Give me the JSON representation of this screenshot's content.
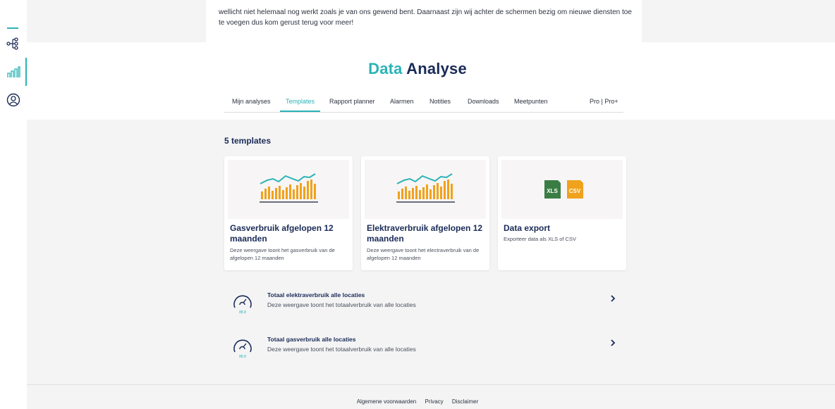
{
  "sidebar": {
    "icons": [
      "network-icon",
      "bar-chart-icon",
      "user-icon"
    ]
  },
  "intro": {
    "text": "wellicht niet helemaal nog werkt zoals je van ons gewend bent. Daarnaast zijn wij achter de schermen bezig om nieuwe diensten toe te voegen dus kom gerust terug voor meer!"
  },
  "page": {
    "title_part1": "Data",
    "title_part2": "Analyse"
  },
  "tabs": [
    {
      "label": "Mijn analyses",
      "active": false
    },
    {
      "label": "Templates",
      "active": true
    },
    {
      "label": "Rapport planner",
      "active": false
    },
    {
      "label": "Alarmen",
      "active": false
    },
    {
      "label": "Notities",
      "active": false
    },
    {
      "label": "Downloads",
      "active": false
    },
    {
      "label": "Meetpunten",
      "active": false
    },
    {
      "label": "Pro | Pro+",
      "active": false
    }
  ],
  "templates": {
    "count_label": "5 templates",
    "cards": [
      {
        "title": "Gasverbruik afgelopen 12 maanden",
        "description": "Deze weergave toont het gasverbruik van de afgelopen 12 maanden",
        "icon": "chart-thumbnail"
      },
      {
        "title": "Elektraverbruik afgelopen 12 maanden",
        "description": "Deze weergave toont het electraverbruik van de afgelopen 12 maanden",
        "icon": "chart-thumbnail"
      },
      {
        "title": "Data export",
        "description": "Exporteer data als XLS of CSV",
        "icon": "file-export-icon",
        "badges": [
          "XLS",
          "CSV"
        ]
      }
    ],
    "rows": [
      {
        "title": "Totaal elektraverbruik alle locaties",
        "description": "Deze weergave toont het totaalverbruik van alle locaties",
        "gauge_value": "88.8"
      },
      {
        "title": "Totaal gasverbruik alle locaties",
        "description": "Deze weergave toont het totaalverbruik van alle locaties",
        "gauge_value": "88.8"
      }
    ]
  },
  "footer": {
    "links": [
      "Algemene voorwaarden",
      "Privacy",
      "Disclaimer"
    ]
  },
  "colors": {
    "accent": "#2bb3b6",
    "navy": "#1a2b57",
    "orange": "#f0a21c",
    "xls_green": "#3a7d44"
  }
}
